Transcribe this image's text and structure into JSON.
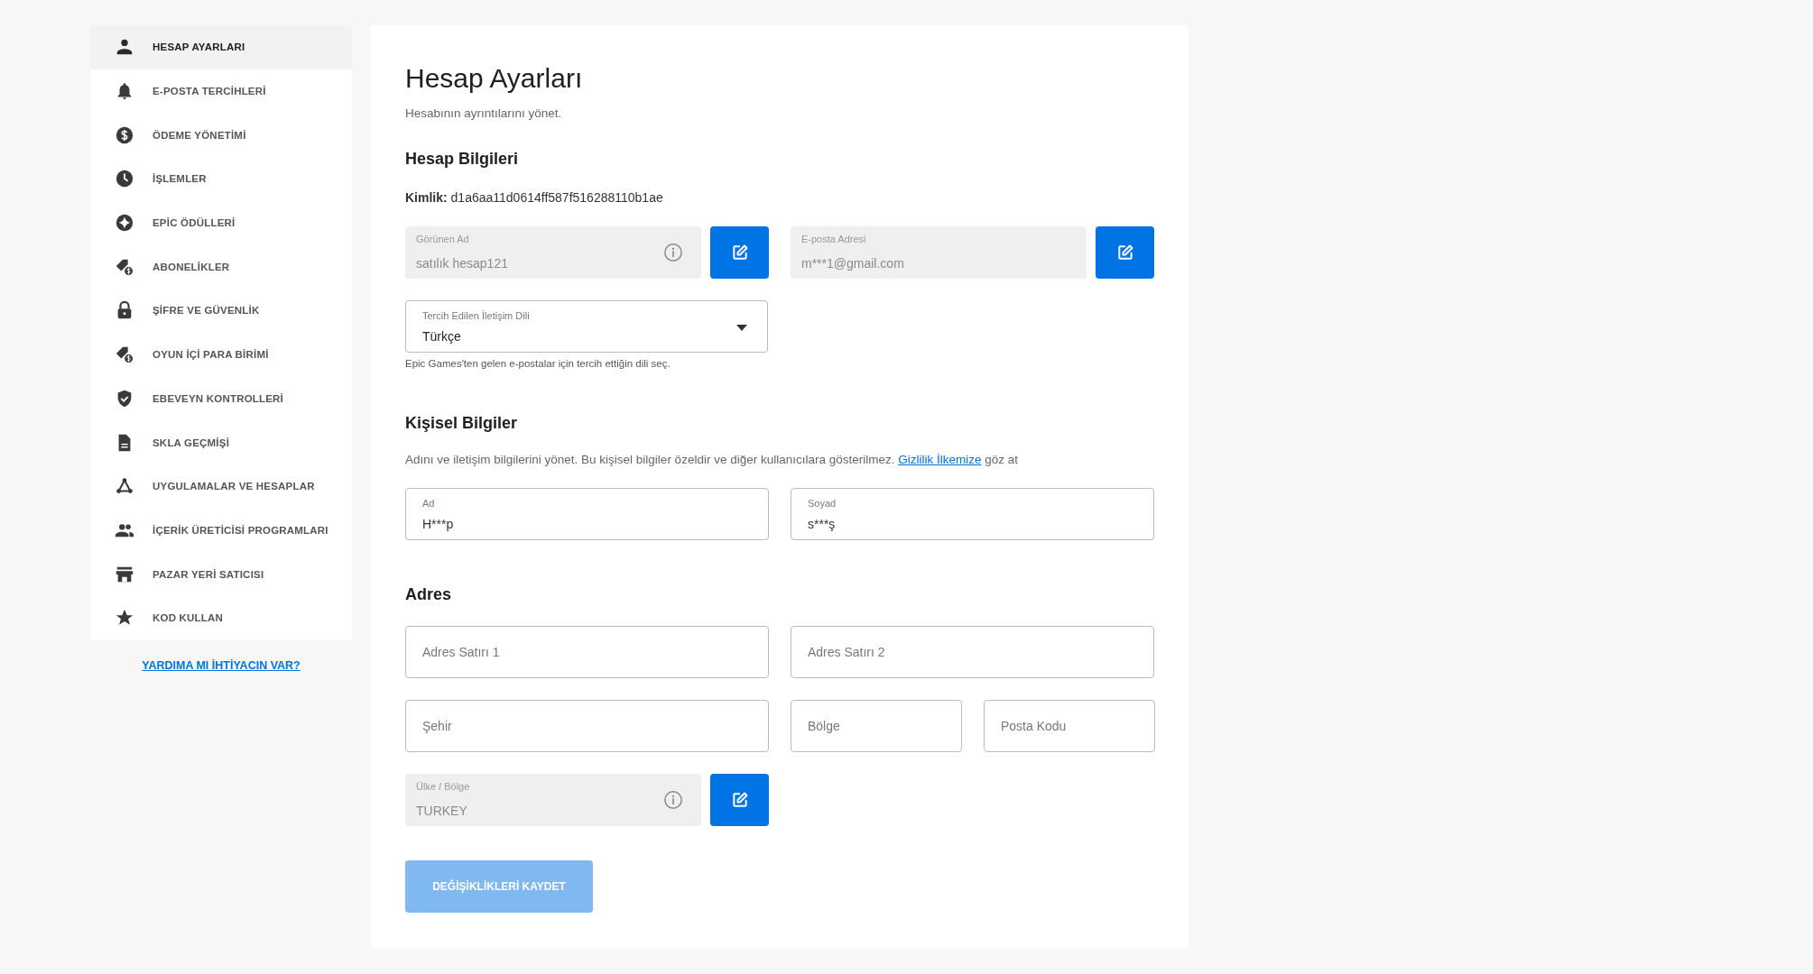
{
  "sidebar": {
    "items": [
      {
        "label": "HESAP AYARLARI",
        "selected": true
      },
      {
        "label": "E-POSTA TERCİHLERİ",
        "selected": false
      },
      {
        "label": "ÖDEME YÖNETİMİ",
        "selected": false
      },
      {
        "label": "İŞLEMLER",
        "selected": false
      },
      {
        "label": "EPİC ÖDÜLLERİ",
        "selected": false
      },
      {
        "label": "ABONELİKLER",
        "selected": false
      },
      {
        "label": "ŞİFRE VE GÜVENLİK",
        "selected": false
      },
      {
        "label": "OYUN İÇİ PARA BİRİMİ",
        "selected": false
      },
      {
        "label": "EBEVEYN KONTROLLERİ",
        "selected": false
      },
      {
        "label": "SKLA GEÇMİŞİ",
        "selected": false
      },
      {
        "label": "UYGULAMALAR VE HESAPLAR",
        "selected": false
      },
      {
        "label": "İÇERİK ÜRETİCİSİ PROGRAMLARI",
        "selected": false
      },
      {
        "label": "PAZAR YERİ SATICISI",
        "selected": false
      },
      {
        "label": "KOD KULLAN",
        "selected": false
      }
    ],
    "help_link": "YARDIMA MI İHTİYACIN VAR?"
  },
  "page": {
    "title": "Hesap Ayarları",
    "subtitle": "Hesabının ayrıntılarını yönet."
  },
  "account": {
    "title": "Hesap Bilgileri",
    "id_line": "**Kimlik:** d1a6aa11d0614ff587f516288110b1ae",
    "locked_fields": [
      {
        "label": "Görünen Ad",
        "value": "satılık hesap121",
        "info": true
      },
      {
        "label": "E-posta Adresi",
        "value": "m***1@gmail.com",
        "info": false
      }
    ],
    "language": {
      "label": "Tercih Edilen İletişim Dili",
      "value": "Türkçe",
      "hint": "Epic Games'ten gelen e-postalar için tercih ettiğin dili seç."
    }
  },
  "personal": {
    "title": "Kişisel Bilgiler",
    "description": "Adını ve iletişim bilgilerini yönet. Bu kişisel bilgiler özeldir ve diğer kullanıcılara gösterilmez.",
    "link": "Gizlilik İlkemize",
    "description_end": "göz at",
    "fields": [
      {
        "label": "Ad",
        "value": "H***p"
      },
      {
        "label": "Soyad",
        "value": "s***ş"
      }
    ]
  },
  "address": {
    "title": "Adres",
    "rows": [
      [
        {
          "placeholder": "Adres Satırı 1"
        },
        {
          "placeholder": "Adres Satırı 2"
        }
      ],
      [
        {
          "placeholder": "Şehir"
        },
        {
          "placeholder": "Bölge"
        },
        {
          "placeholder": "Posta Kodu"
        }
      ]
    ],
    "country": {
      "label": "Ülke / Bölge",
      "value": "TURKEY",
      "info": true
    }
  },
  "save_button": {
    "label": "DEĞİŞİKLİKLERİ KAYDET",
    "disabled": true
  }
}
